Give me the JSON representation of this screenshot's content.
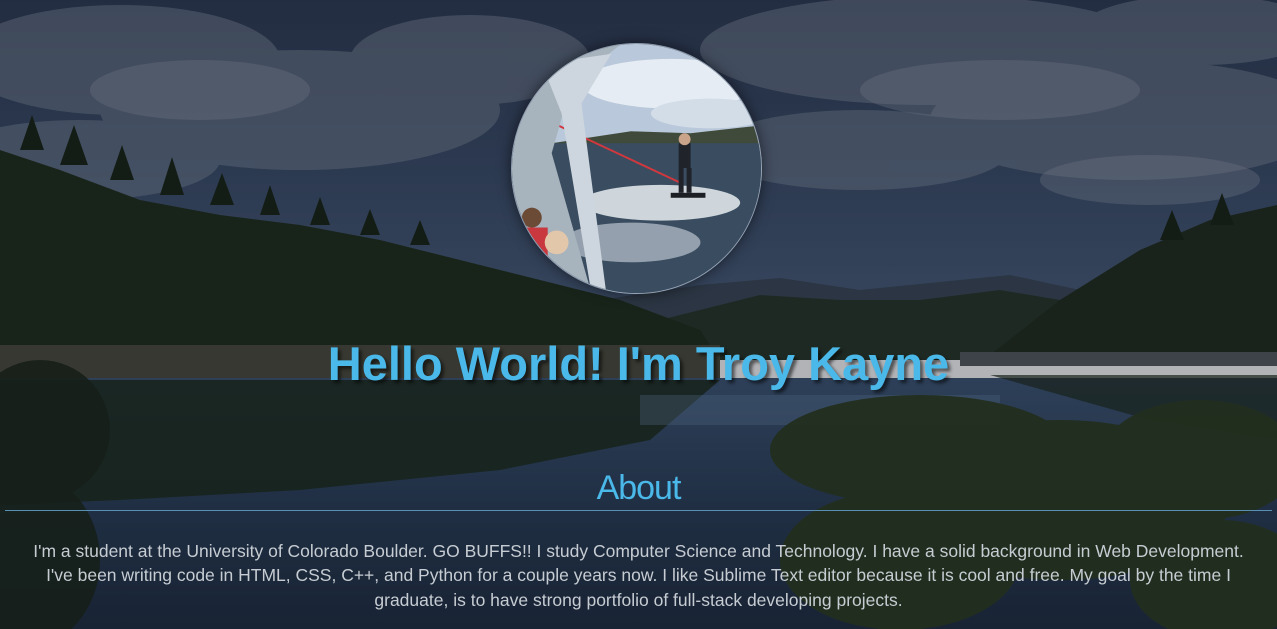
{
  "colors": {
    "accent": "#4ab8e8",
    "text": "#c6ccd2",
    "divider": "#5a8fb4"
  },
  "hero": {
    "greeting": "Hello World! I'm Troy Kayne"
  },
  "about": {
    "title": "About",
    "body": "I'm a student at the University of Colorado Boulder. GO BUFFS!! I study Computer Science and Technology. I have a solid background in Web Development. I've been writing code in HTML, CSS, C++, and Python for a couple years now. I like Sublime Text editor because it is cool and free. My goal by the time I graduate, is to have strong portfolio of full-stack developing projects."
  }
}
